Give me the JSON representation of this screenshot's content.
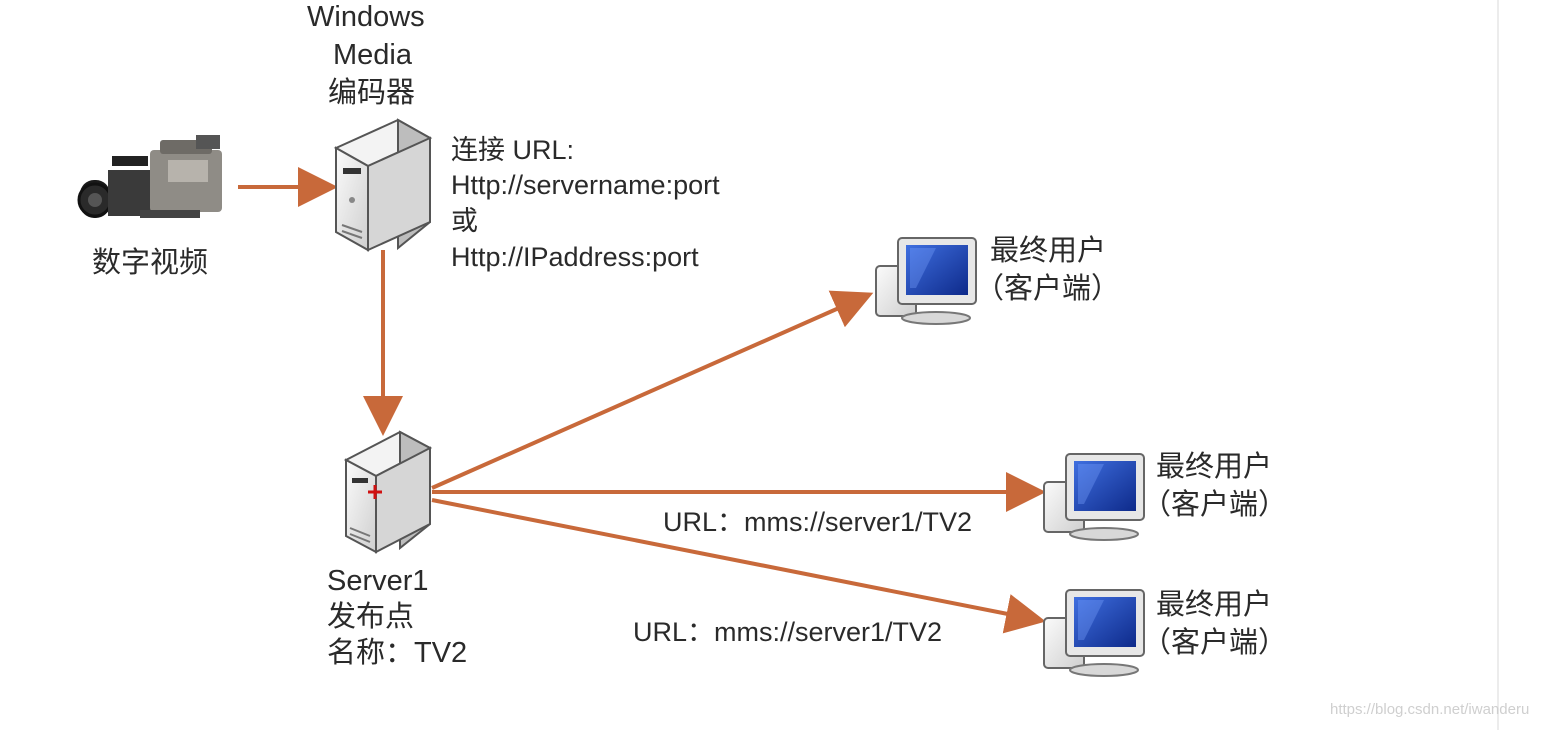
{
  "encoder": {
    "title_line1": "Windows",
    "title_line2": "Media",
    "title_line3": "编码器",
    "connect_label": "连接 URL:",
    "url_option1": "Http://servername:port",
    "or_label": "或",
    "url_option2": "Http://IPaddress:port"
  },
  "source": {
    "label": "数字视频",
    "icon": "video-camera-icon"
  },
  "server": {
    "name": "Server1",
    "publish_point": "发布点",
    "name_label": "名称：TV2"
  },
  "clients": [
    {
      "line1": "最终用户",
      "line2": "（客户端）"
    },
    {
      "line1": "最终用户",
      "line2": "（客户端）"
    },
    {
      "line1": "最终用户",
      "line2": "（客户端）"
    }
  ],
  "urls": {
    "middle": "URL：mms://server1/TV2",
    "bottom": "URL：mms://server1/TV2"
  },
  "watermark": "https://blog.csdn.net/iwanderu",
  "colors": {
    "arrow": "#c8693a",
    "screen": "#1a3fb0",
    "case": "#e6e6e6"
  }
}
